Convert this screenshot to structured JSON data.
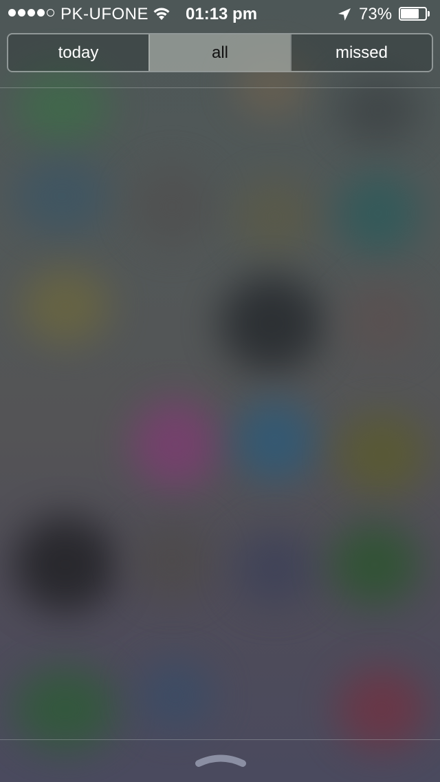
{
  "status_bar": {
    "signal_bars_filled": 4,
    "signal_bars_total": 5,
    "carrier": "PK-UFONE",
    "wifi_icon": "wifi-icon",
    "time": "01:13 pm",
    "location_icon": "location-arrow-icon",
    "battery_percent": "73%",
    "battery_level": 0.73
  },
  "segmented_control": {
    "segments": [
      {
        "label": "today"
      },
      {
        "label": "all"
      },
      {
        "label": "missed"
      }
    ],
    "selected": "all"
  },
  "bottom_handle_icon": "chevron-up-handle-icon",
  "colors": {
    "text": "#ffffff",
    "selected_segment_bg": "#a0a5a0",
    "selected_segment_text": "#111111"
  }
}
